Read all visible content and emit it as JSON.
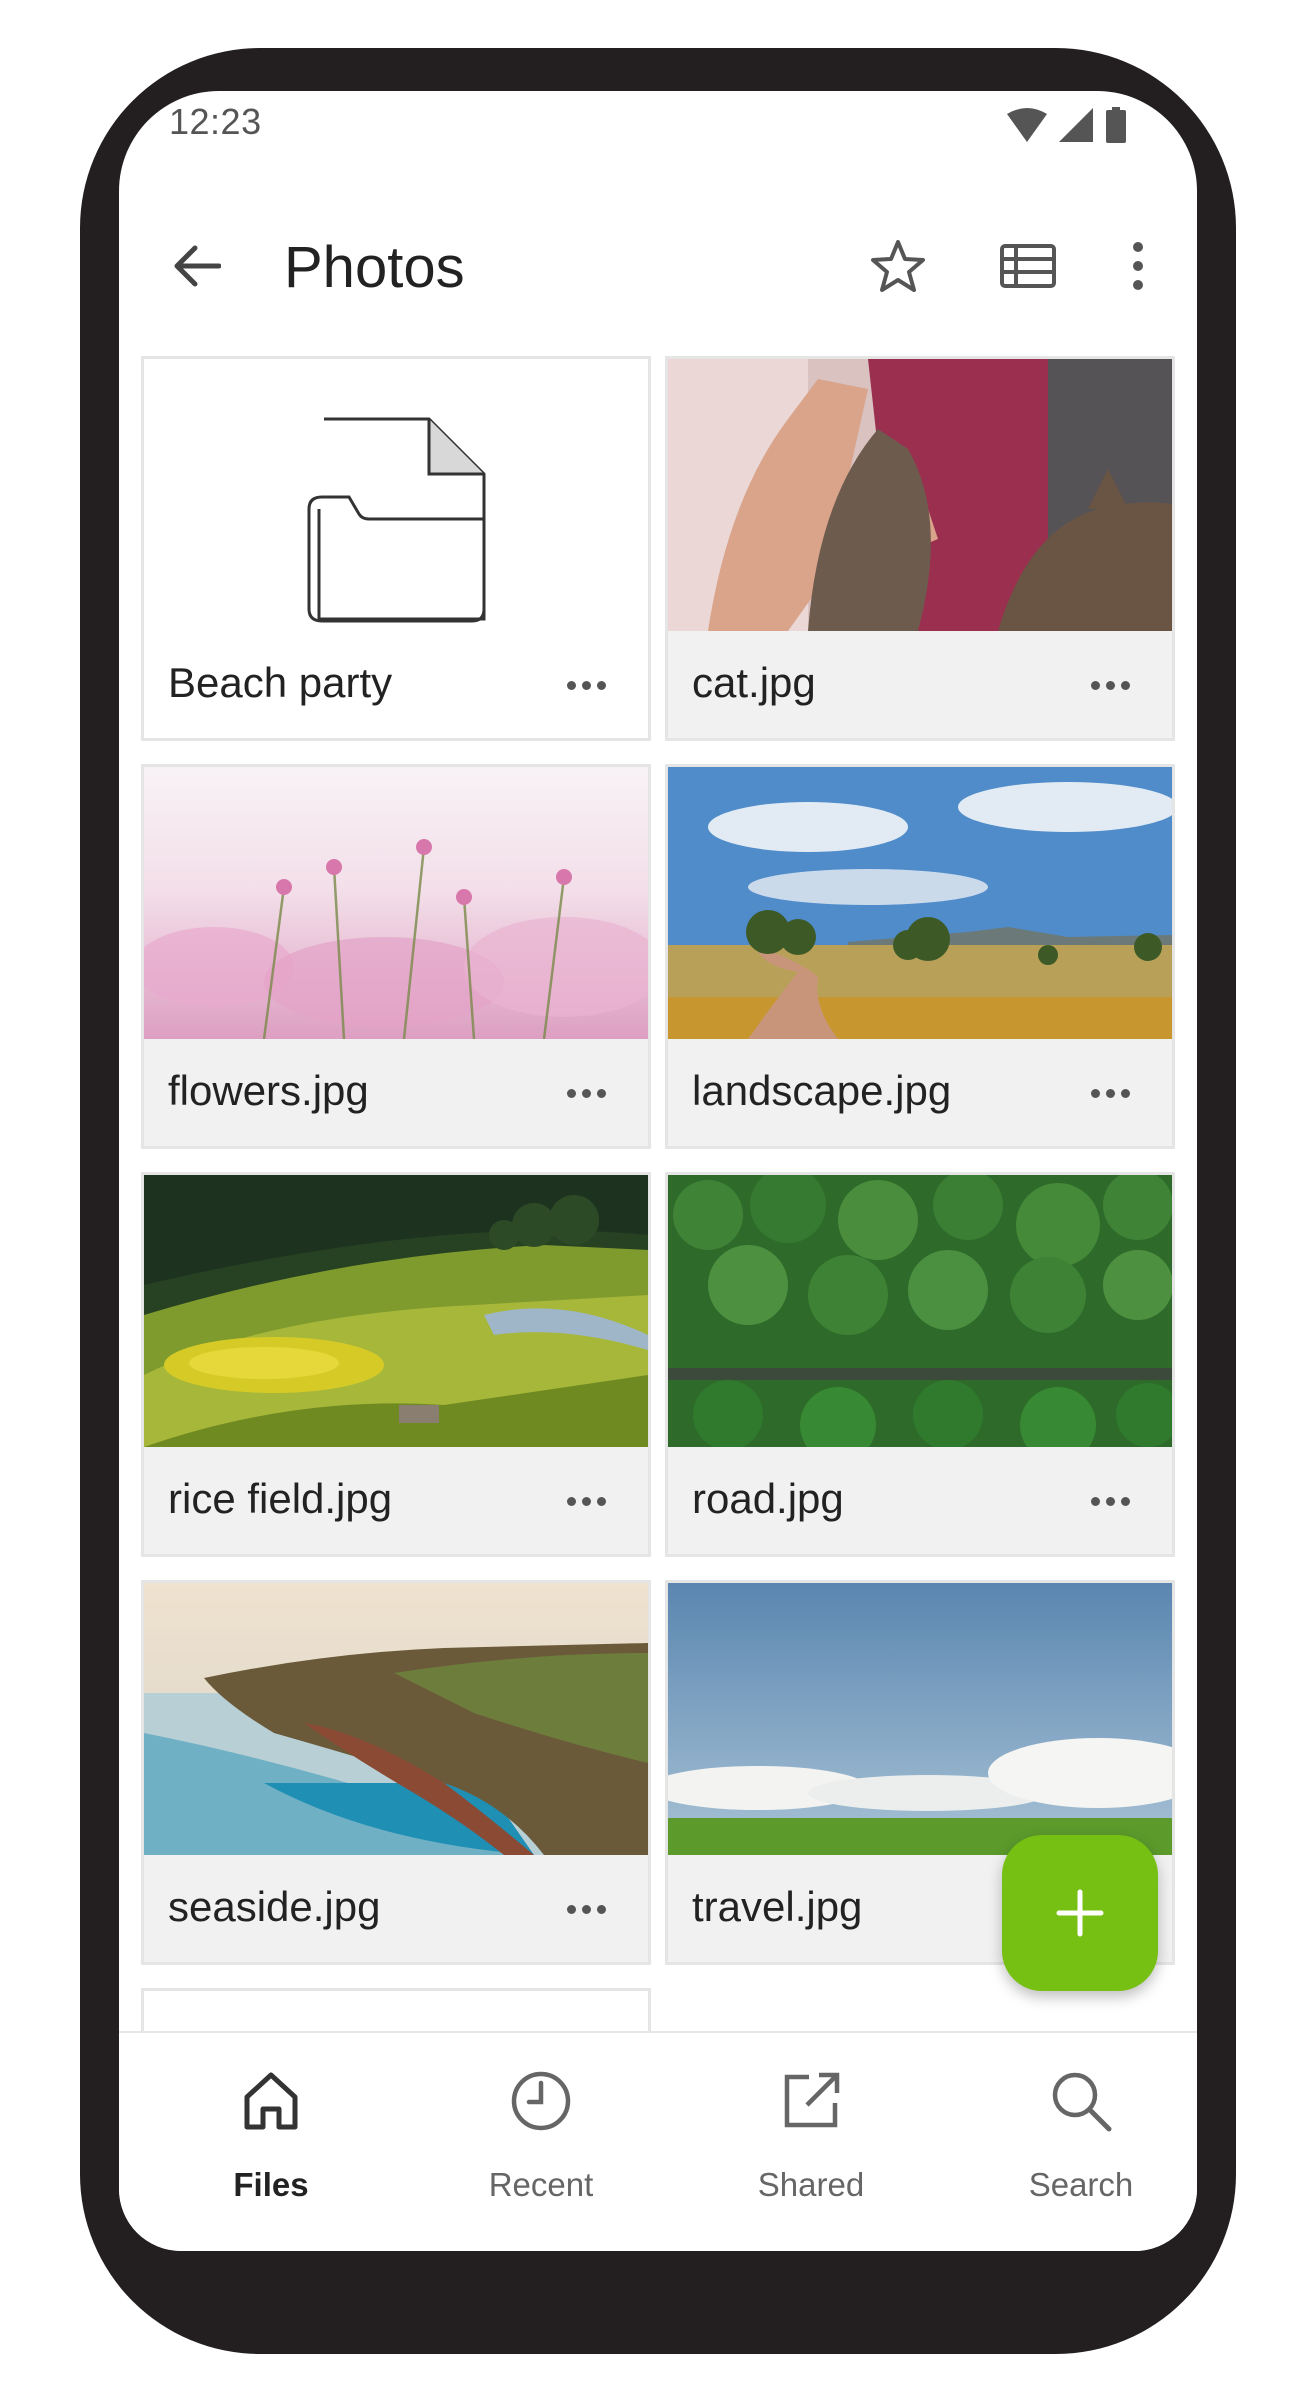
{
  "status_bar": {
    "time": "12:23",
    "icons": [
      "wifi-icon",
      "signal-icon",
      "battery-icon"
    ]
  },
  "app_bar": {
    "title": "Photos",
    "actions": [
      "star-icon",
      "list-view-icon",
      "more-vertical-icon"
    ]
  },
  "files": [
    {
      "name": "Beach party",
      "type": "folder"
    },
    {
      "name": "cat.jpg",
      "type": "image"
    },
    {
      "name": "flowers.jpg",
      "type": "image"
    },
    {
      "name": "landscape.jpg",
      "type": "image"
    },
    {
      "name": "rice field.jpg",
      "type": "image"
    },
    {
      "name": "road.jpg",
      "type": "image"
    },
    {
      "name": "seaside.jpg",
      "type": "image"
    },
    {
      "name": "travel.jpg",
      "type": "image"
    }
  ],
  "fab": {
    "icon": "plus-icon"
  },
  "bottom_nav": {
    "items": [
      {
        "label": "Files",
        "icon": "home-icon",
        "active": true
      },
      {
        "label": "Recent",
        "icon": "clock-icon",
        "active": false
      },
      {
        "label": "Shared",
        "icon": "share-icon",
        "active": false
      },
      {
        "label": "Search",
        "icon": "search-icon",
        "active": false
      }
    ]
  },
  "colors": {
    "accent": "#76c014",
    "device_frame": "#231f20",
    "text_primary": "#222222",
    "text_secondary": "#666666"
  }
}
